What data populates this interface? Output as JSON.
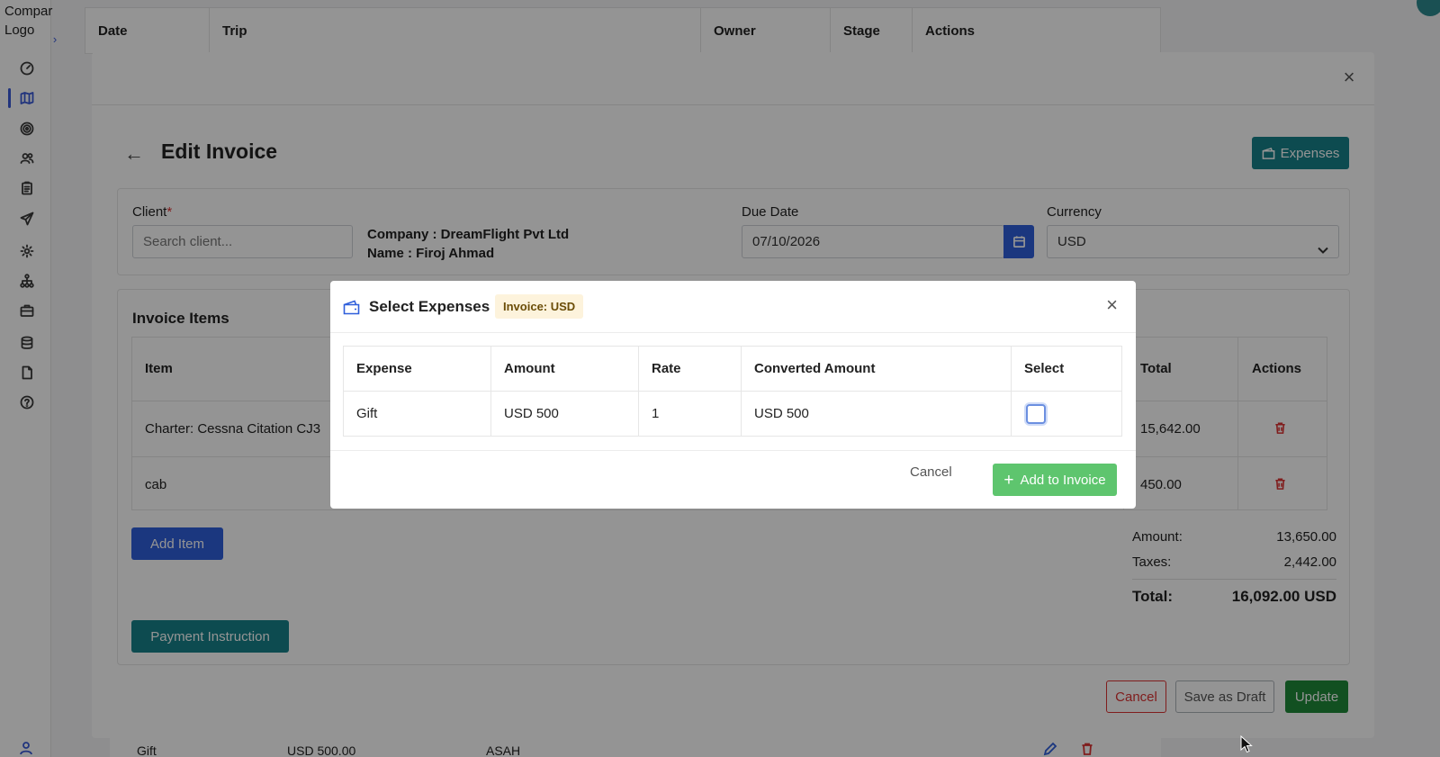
{
  "app": {
    "logo_text": "Compar\nLogo"
  },
  "background_table": {
    "headers": [
      "Date",
      "Trip",
      "Owner",
      "Stage",
      "Actions"
    ],
    "peek_row": {
      "item": "Gift",
      "amount": "USD 500.00",
      "col3": "ASAH"
    }
  },
  "sidebar": {
    "items": [
      "dashboard-icon",
      "map-icon",
      "target-icon",
      "users-icon",
      "clipboard-icon",
      "send-icon",
      "settings-icon",
      "network-icon",
      "briefcase-icon",
      "database-icon",
      "file-icon",
      "help-icon"
    ],
    "active_index": 1
  },
  "invoice_modal": {
    "title": "Edit Invoice",
    "expenses_button": "Expenses",
    "client_label": "Client",
    "client_required": "*",
    "client_placeholder": "Search client...",
    "company_line": "Company : DreamFlight Pvt Ltd",
    "name_line": "Name : Firoj Ahmad",
    "due_date_label": "Due Date",
    "due_date_value": "07/10/2026",
    "currency_label": "Currency",
    "currency_value": "USD",
    "items_section_title": "Invoice Items",
    "items_headers": {
      "item": "Item",
      "total": "Total",
      "actions": "Actions"
    },
    "items": [
      {
        "item": "Charter: Cessna Citation CJ3",
        "total": "15,642.00"
      },
      {
        "item": "cab",
        "total": "450.00"
      }
    ],
    "add_item_button": "Add Item",
    "payment_instruction_button": "Payment Instruction",
    "summary": {
      "amount_label": "Amount:",
      "amount_value": "13,650.00",
      "taxes_label": "Taxes:",
      "taxes_value": "2,442.00",
      "total_label": "Total:",
      "total_value": "16,092.00 USD"
    },
    "footer": {
      "cancel": "Cancel",
      "save_draft": "Save as Draft",
      "update": "Update"
    }
  },
  "expenses_dialog": {
    "title": "Select Expenses",
    "badge": "Invoice: USD",
    "headers": [
      "Expense",
      "Amount",
      "Rate",
      "Converted Amount",
      "Select"
    ],
    "rows": [
      {
        "expense": "Gift",
        "amount": "USD 500",
        "rate": "1",
        "converted": "USD 500",
        "selected": false
      }
    ],
    "cancel": "Cancel",
    "add_button": "Add to Invoice"
  },
  "colors": {
    "primary_blue": "#2f5fdb",
    "teal": "#17828a",
    "green": "#1f8a3a",
    "light_green": "#5ec56e",
    "danger": "#d33333"
  }
}
